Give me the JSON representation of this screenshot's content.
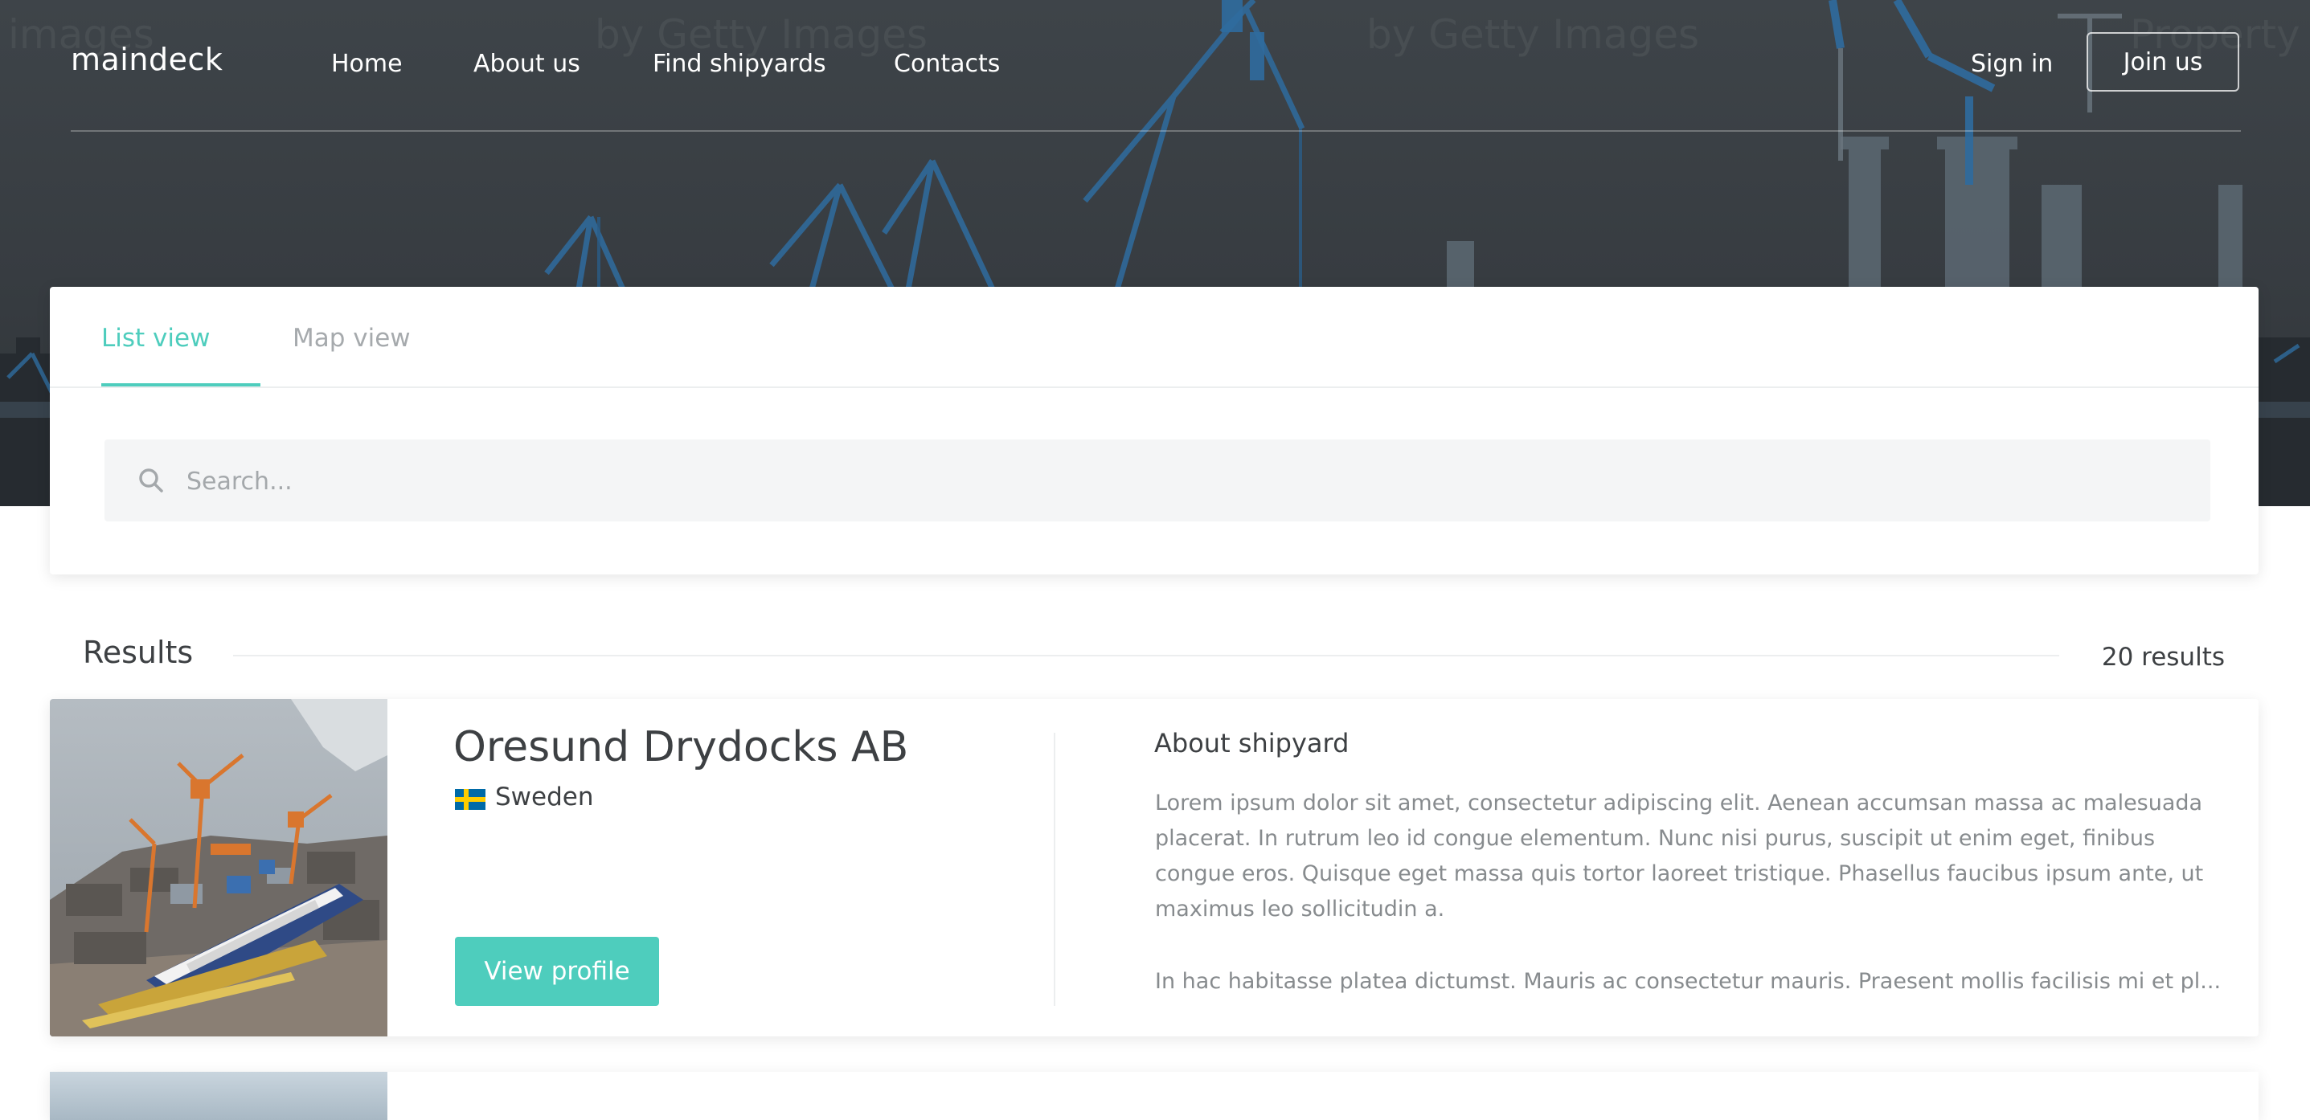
{
  "brand": {
    "logo": "maindeck",
    "accent_color": "#4ecdbd"
  },
  "hero": {
    "watermarks": [
      "images",
      "by Getty Images",
      "by Getty Images",
      "Property"
    ]
  },
  "nav": {
    "links": [
      {
        "label": "Home"
      },
      {
        "label": "About us"
      },
      {
        "label": "Find shipyards"
      },
      {
        "label": "Contacts"
      }
    ],
    "signin_label": "Sign in",
    "join_label": "Join us"
  },
  "tabs": [
    {
      "label": "List view",
      "active": true
    },
    {
      "label": "Map view",
      "active": false
    }
  ],
  "search": {
    "placeholder": "Search...",
    "icon": "search-icon"
  },
  "results": {
    "title": "Results",
    "count": "20 results",
    "items": [
      {
        "name": "Oresund Drydocks AB",
        "country": "Sweden",
        "flag": "sweden-flag-icon",
        "button_label": "View profile",
        "about_title": "About shipyard",
        "about_text": "Lorem ipsum dolor sit amet, consectetur adipiscing elit. Aenean accumsan massa ac malesuada placerat. In rutrum leo id congue elementum. Nunc nisi purus, suscipit ut enim eget, finibus congue eros. Quisque eget massa quis tortor laoreet tristique. Phasellus faucibus ipsum ante, ut maximus leo sollicitudin a.",
        "about_text_2": "In hac habitasse platea dictumst. Mauris ac consectetur mauris. Praesent mollis facilisis mi et pl..."
      }
    ]
  }
}
